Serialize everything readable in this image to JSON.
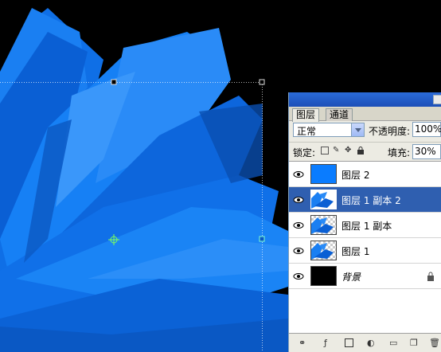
{
  "panel": {
    "tabs": [
      {
        "label": "图层"
      },
      {
        "label": "通道"
      }
    ],
    "blend_mode": "正常",
    "opacity_label": "不透明度:",
    "opacity_value": "100%",
    "lock_label": "锁定:",
    "fill_label": "填充:",
    "fill_value": "30%",
    "layers": [
      {
        "name": "图层 2",
        "thumb": "blue-fill",
        "selected": false
      },
      {
        "name": "图层 1 副本 2",
        "thumb": "transparent-shape",
        "selected": true
      },
      {
        "name": "图层 1 副本",
        "thumb": "transparent-shape",
        "selected": false
      },
      {
        "name": "图层 1",
        "thumb": "transparent-shape",
        "selected": false
      },
      {
        "name": "背景",
        "thumb": "black-fill",
        "selected": false,
        "locked": true
      }
    ]
  },
  "colors": {
    "canvas_bg": "#000000",
    "shape_blue": "#1478f0",
    "selected_layer": "#2f5fb0",
    "panel_title": "#2a6bd8"
  }
}
